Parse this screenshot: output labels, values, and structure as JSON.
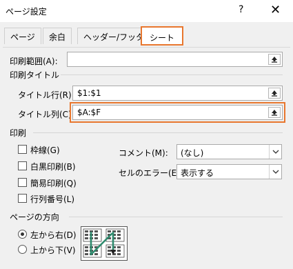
{
  "window": {
    "title": "ページ設定",
    "help_label": "?",
    "close_label": "✕"
  },
  "tabs": [
    {
      "label": "ページ"
    },
    {
      "label": "余白"
    },
    {
      "label": "ヘッダー/フッター"
    },
    {
      "label": "シート"
    }
  ],
  "print_area": {
    "label": "印刷範囲(A):",
    "value": ""
  },
  "print_titles": {
    "section_label": "印刷タイトル",
    "rows": {
      "label": "タイトル行(R):",
      "value": "$1:$1"
    },
    "columns": {
      "label": "タイトル列(C):",
      "value": "$A:$F"
    }
  },
  "print": {
    "section_label": "印刷",
    "checkboxes": [
      {
        "label": "枠線(G)",
        "checked": false
      },
      {
        "label": "白黒印刷(B)",
        "checked": false
      },
      {
        "label": "簡易印刷(Q)",
        "checked": false
      },
      {
        "label": "行列番号(L)",
        "checked": false
      }
    ],
    "comments": {
      "label": "コメント(M):",
      "value": "(なし)"
    },
    "cell_errors": {
      "label": "セルのエラー(E):",
      "value": "表示する"
    }
  },
  "page_order": {
    "section_label": "ページの方向",
    "options": [
      {
        "label": "左から右(D)",
        "selected": true
      },
      {
        "label": "上から下(V)",
        "selected": false
      }
    ]
  },
  "colors": {
    "highlight": "#e8762d",
    "arrow": "#2e8b6e"
  }
}
